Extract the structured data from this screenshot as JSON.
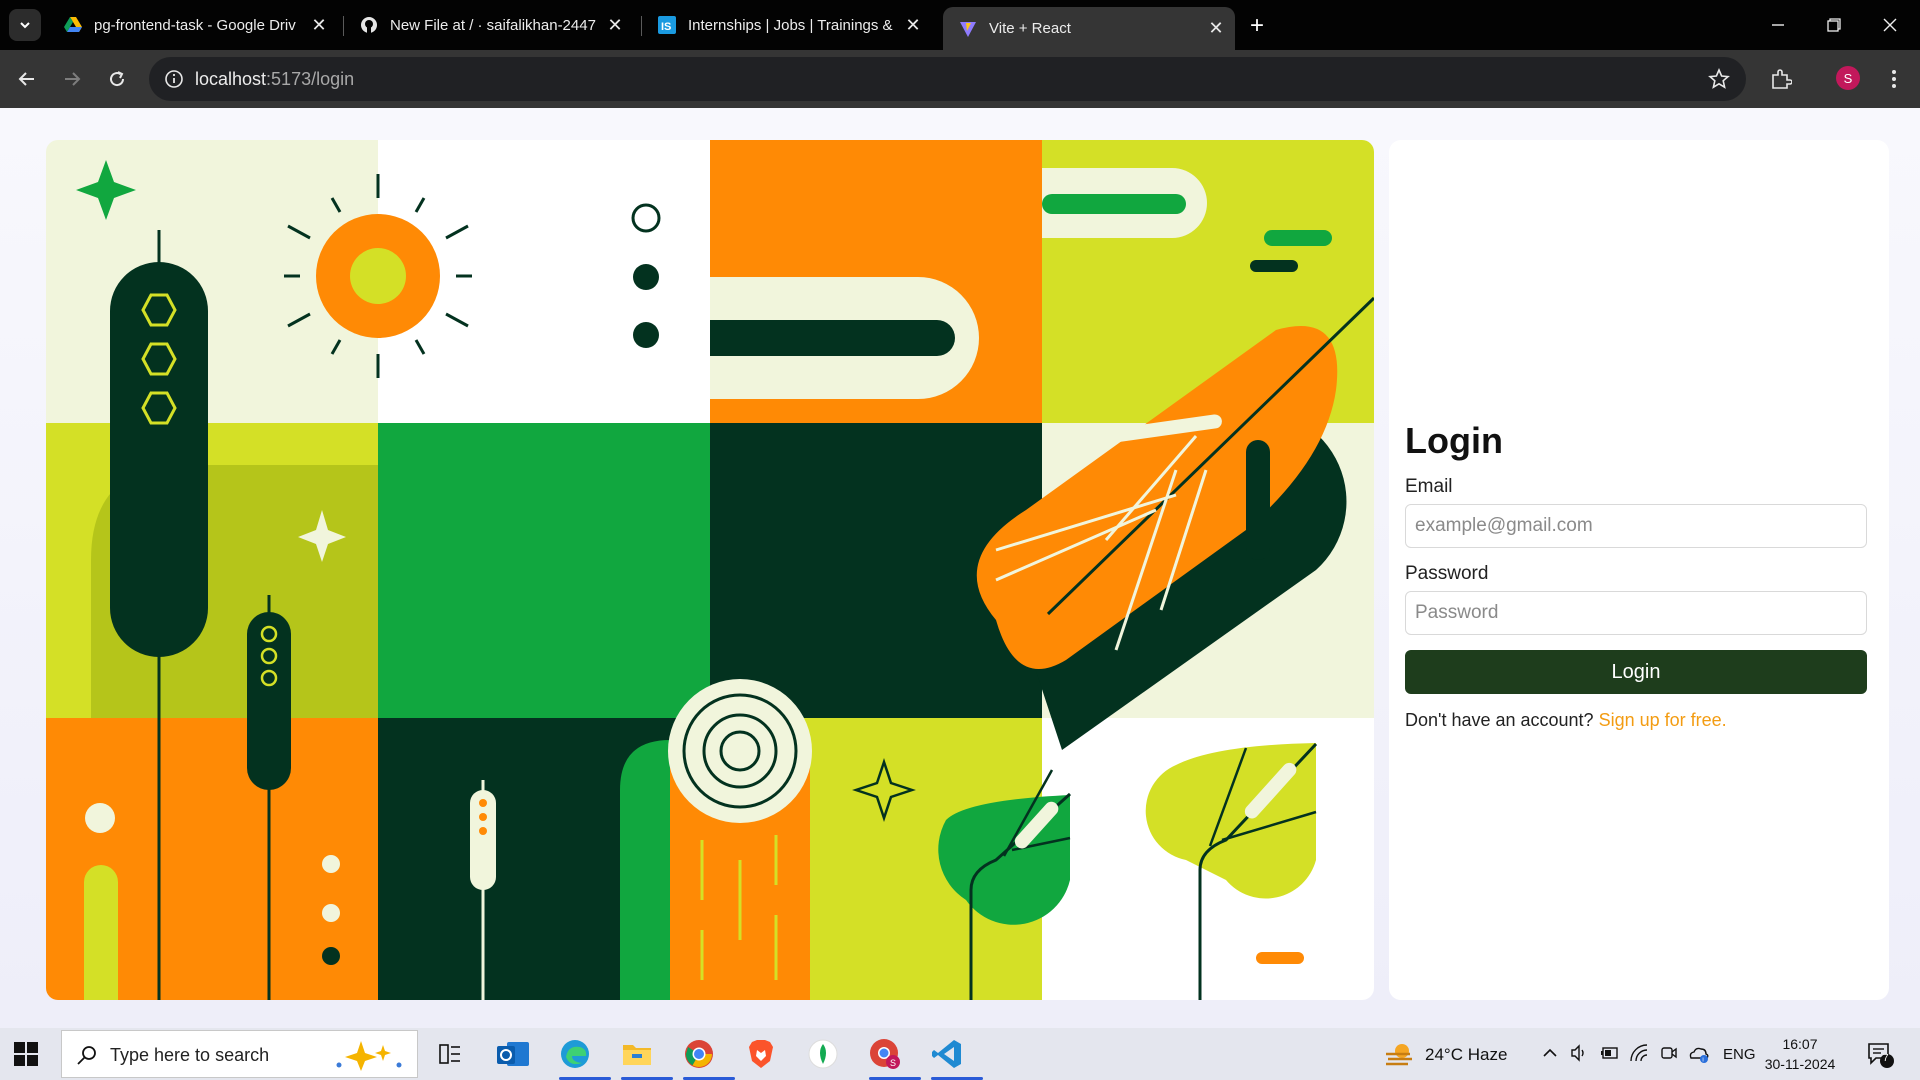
{
  "browser": {
    "tabs": [
      {
        "title": "pg-frontend-task - Google Driv",
        "favicon": "google-drive-icon",
        "active": false
      },
      {
        "title": "New File at / · saifalikhan-2447",
        "favicon": "github-icon",
        "active": false
      },
      {
        "title": "Internships | Jobs | Trainings & I",
        "favicon": "internshala-icon",
        "active": false
      },
      {
        "title": "Vite + React",
        "favicon": "vite-icon",
        "active": true
      }
    ],
    "url_host": "localhost",
    "url_path": ":5173/login",
    "profile_initial": "S"
  },
  "login": {
    "title": "Login",
    "email_label": "Email",
    "email_placeholder": "example@gmail.com",
    "password_label": "Password",
    "password_placeholder": "Password",
    "button_label": "Login",
    "signup_prompt": "Don't have an account?",
    "signup_link": "Sign up for free."
  },
  "taskbar": {
    "search_placeholder": "Type here to search",
    "weather": "24°C  Haze",
    "language": "ENG",
    "time": "16:07",
    "date": "30-11-2024",
    "notification_count": "7"
  },
  "colors": {
    "dark_green": "#03321f",
    "green": "#11a73f",
    "lime": "#d4e026",
    "olive": "#b5c51a",
    "orange": "#ff8a05",
    "cream": "#f1f5dc",
    "button": "#1e3d1c",
    "link": "#f39c12"
  }
}
